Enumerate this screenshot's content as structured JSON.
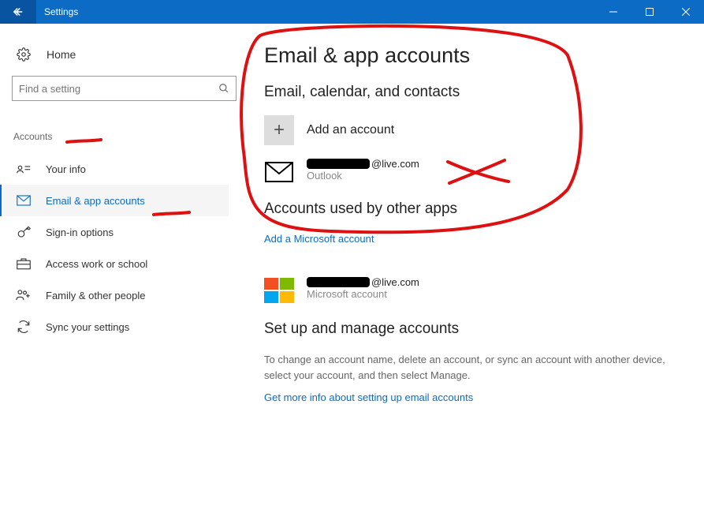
{
  "titlebar": {
    "title": "Settings"
  },
  "sidebar": {
    "home": "Home",
    "searchPlaceholder": "Find a setting",
    "section": "Accounts",
    "items": [
      {
        "label": "Your info"
      },
      {
        "label": "Email & app accounts"
      },
      {
        "label": "Sign-in options"
      },
      {
        "label": "Access work or school"
      },
      {
        "label": "Family & other people"
      },
      {
        "label": "Sync your settings"
      }
    ]
  },
  "main": {
    "heading": "Email & app accounts",
    "section1": "Email, calendar, and contacts",
    "addAccount": "Add an account",
    "emailSuffix": "@live.com",
    "emailProvider": "Outlook",
    "section2": "Accounts used by other apps",
    "addMsAccount": "Add a Microsoft account",
    "msEmailSuffix": "@live.com",
    "msAccountType": "Microsoft account",
    "section3": "Set up and manage accounts",
    "manageText": "To change an account name, delete an account, or sync an account with another device, select your account, and then select Manage.",
    "moreInfoLink": "Get more info about setting up email accounts"
  }
}
